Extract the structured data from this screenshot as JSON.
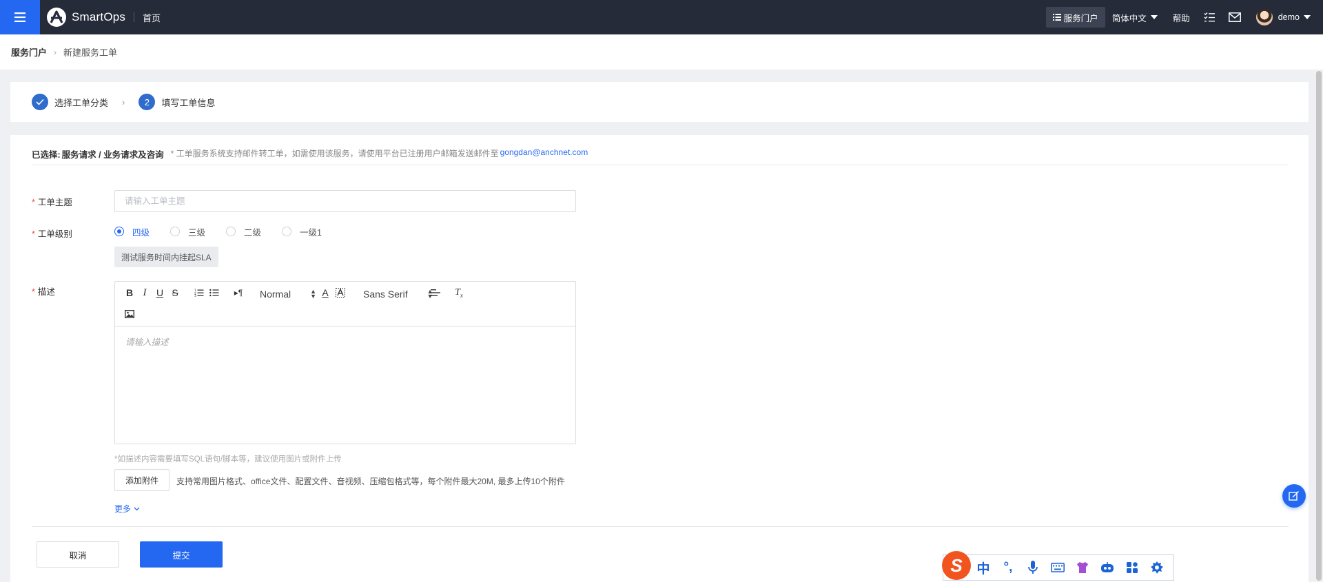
{
  "topbar": {
    "brand": "SmartOps",
    "home": "首页",
    "portal": "服务门户",
    "language": "简体中文",
    "help": "帮助",
    "user": "demo"
  },
  "breadcrumb": {
    "root": "服务门户",
    "current": "新建服务工单"
  },
  "steps": [
    {
      "label": "选择工单分类",
      "status": "done"
    },
    {
      "number": "2",
      "label": "填写工单信息",
      "status": "current"
    }
  ],
  "selection": {
    "label": "已选择:",
    "path": "服务请求 / 业务请求及咨询",
    "note": "* 工单服务系统支持邮件转工单，如需使用该服务，请使用平台已注册用户邮箱发送邮件至",
    "email": "gongdan@anchnet.com"
  },
  "form": {
    "subject_label": "工单主题",
    "subject_placeholder": "请输入工单主题",
    "level_label": "工单级别",
    "levels": [
      "四级",
      "三级",
      "二级",
      "一级1"
    ],
    "selected_level": "四级",
    "sla_tag": "测试服务时间内挂起SLA",
    "desc_label": "描述",
    "desc_placeholder": "请输入描述",
    "desc_hint": "*如描述内容需要填写SQL语句/脚本等，建议使用图片或附件上传",
    "attach_button": "添加附件",
    "attach_note": "支持常用图片格式、office文件、配置文件、音视频、压缩包格式等，每个附件最大20M, 最多上传10个附件",
    "more": "更多"
  },
  "editor_toolbar": {
    "format_select": "Normal",
    "font_select": "Sans Serif"
  },
  "actions": {
    "cancel": "取消",
    "submit": "提交"
  },
  "ime": {
    "mode": "中",
    "punct": "°,"
  },
  "colors": {
    "topbar_bg": "#262b3a",
    "accent": "#2468f2",
    "step_blue": "#2f6ccc",
    "required": "#f24a4a"
  }
}
